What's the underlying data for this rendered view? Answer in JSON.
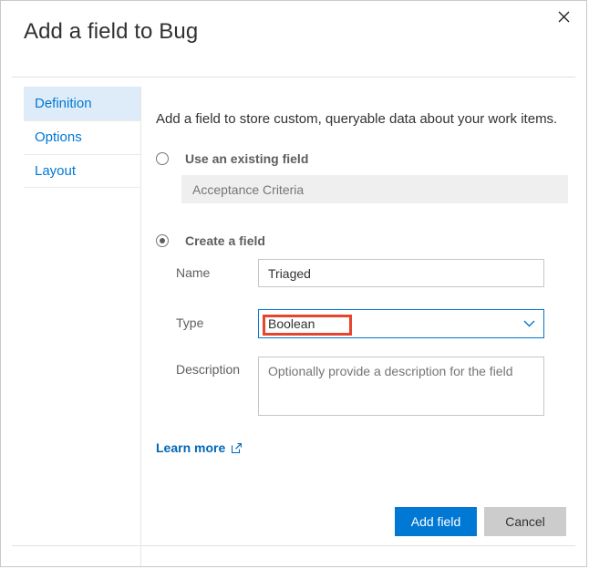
{
  "dialog": {
    "title": "Add a field to Bug",
    "close_icon": "close-icon"
  },
  "tabs": [
    {
      "label": "Definition",
      "selected": true
    },
    {
      "label": "Options",
      "selected": false
    },
    {
      "label": "Layout",
      "selected": false
    }
  ],
  "content": {
    "intro": "Add a field to store custom, queryable data about your work items.",
    "existing_option": {
      "label": "Use an existing field",
      "selected": false,
      "value": "Acceptance Criteria"
    },
    "create_option": {
      "label": "Create a field",
      "selected": true
    },
    "fields": {
      "name": {
        "label": "Name",
        "value": "Triaged",
        "placeholder": ""
      },
      "type": {
        "label": "Type",
        "value": "Boolean",
        "chevron_icon": "chevron-down-icon",
        "highlight_color": "#e8442d",
        "focus_color": "#0078d4"
      },
      "description": {
        "label": "Description",
        "value": "",
        "placeholder": "Optionally provide a description for the field"
      }
    },
    "learn_more": {
      "label": "Learn more",
      "icon": "external-link-icon"
    }
  },
  "footer": {
    "primary_label": "Add field",
    "secondary_label": "Cancel",
    "primary_color": "#0078d4",
    "secondary_color": "#cccccc"
  }
}
